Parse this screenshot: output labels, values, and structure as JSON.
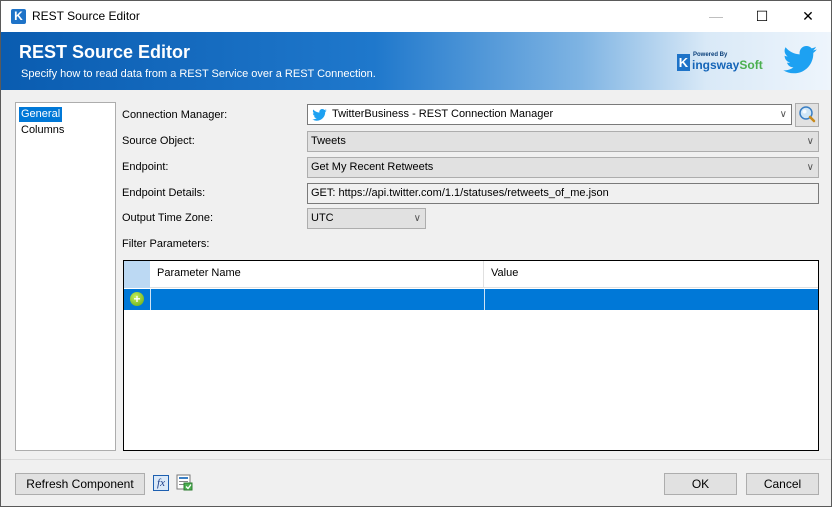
{
  "window": {
    "title": "REST Source Editor",
    "controls": {
      "minimize": "—",
      "maximize": "☐",
      "close": "✕"
    }
  },
  "banner": {
    "title": "REST Source Editor",
    "subtitle": "Specify how to read data from a REST Service over a REST Connection.",
    "logo": {
      "powered_by": "Powered By",
      "brand_k": "K",
      "brand_name": "ingsway",
      "brand_soft": "Soft"
    }
  },
  "nav": {
    "items": [
      {
        "label": "General",
        "selected": true
      },
      {
        "label": "Columns",
        "selected": false
      }
    ]
  },
  "form": {
    "connection_manager": {
      "label": "Connection Manager:",
      "value": "TwitterBusiness - REST Connection Manager"
    },
    "source_object": {
      "label": "Source Object:",
      "value": "Tweets"
    },
    "endpoint": {
      "label": "Endpoint:",
      "value": "Get My Recent Retweets"
    },
    "endpoint_details": {
      "label": "Endpoint Details:",
      "value": "GET: https://api.twitter.com/1.1/statuses/retweets_of_me.json"
    },
    "output_time_zone": {
      "label": "Output Time Zone:",
      "value": "UTC"
    },
    "filter_parameters": {
      "label": "Filter Parameters:"
    }
  },
  "grid": {
    "columns": [
      "Parameter Name",
      "Value"
    ],
    "rows": [
      {
        "parameter_name": "",
        "value": ""
      }
    ],
    "selection_color": "#0078d7"
  },
  "footer": {
    "refresh_label": "Refresh Component",
    "ok_label": "OK",
    "cancel_label": "Cancel",
    "fx_label": "fx"
  },
  "colors": {
    "accent": "#0078d7",
    "banner": "#1f78cc",
    "twitter": "#1da1f2"
  }
}
